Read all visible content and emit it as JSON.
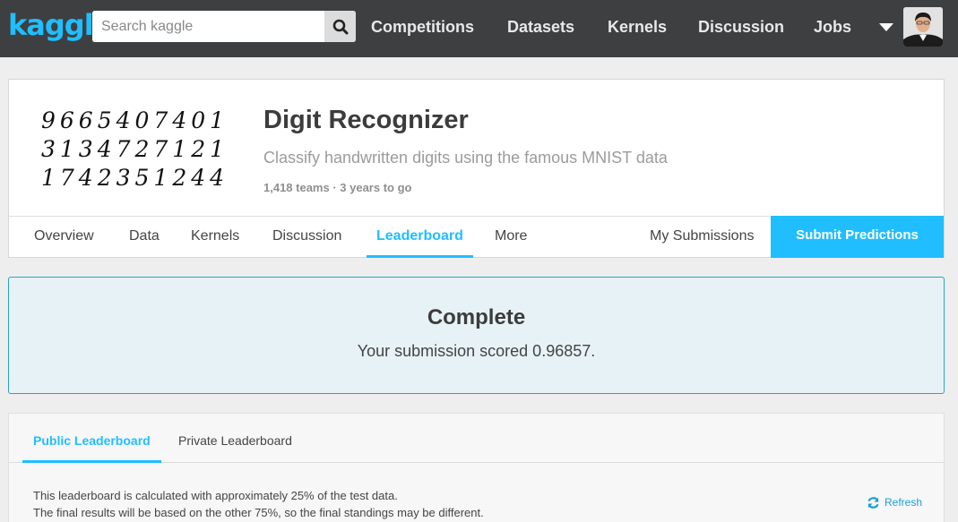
{
  "topnav": {
    "logo": "kaggle",
    "search_placeholder": "Search kaggle",
    "links": [
      "Competitions",
      "Datasets",
      "Kernels",
      "Discussion",
      "Jobs"
    ]
  },
  "competition": {
    "title": "Digit Recognizer",
    "subtitle": "Classify handwritten digits using the famous MNIST data",
    "meta": "1,418 teams · 3 years to go",
    "thumbnail_digits": [
      "9665407401",
      "3134727121",
      "1742351244"
    ],
    "tabs": [
      "Overview",
      "Data",
      "Kernels",
      "Discussion",
      "Leaderboard",
      "More"
    ],
    "active_tab": "Leaderboard",
    "my_submissions": "My Submissions",
    "submit_label": "Submit Predictions"
  },
  "banner": {
    "title": "Complete",
    "message": "Your submission scored 0.96857."
  },
  "leaderboard": {
    "tabs": [
      "Public Leaderboard",
      "Private Leaderboard"
    ],
    "active_tab": "Public Leaderboard",
    "note_line1": "This leaderboard is calculated with approximately 25% of the test data.",
    "note_line2": "The final results will be based on the other 75%, so the final standings may be different.",
    "refresh_label": "Refresh"
  },
  "colors": {
    "accent": "#20beff",
    "topbar": "#3e3f41",
    "banner_bg": "#e7f2f6",
    "banner_border": "#2aa5bf"
  }
}
